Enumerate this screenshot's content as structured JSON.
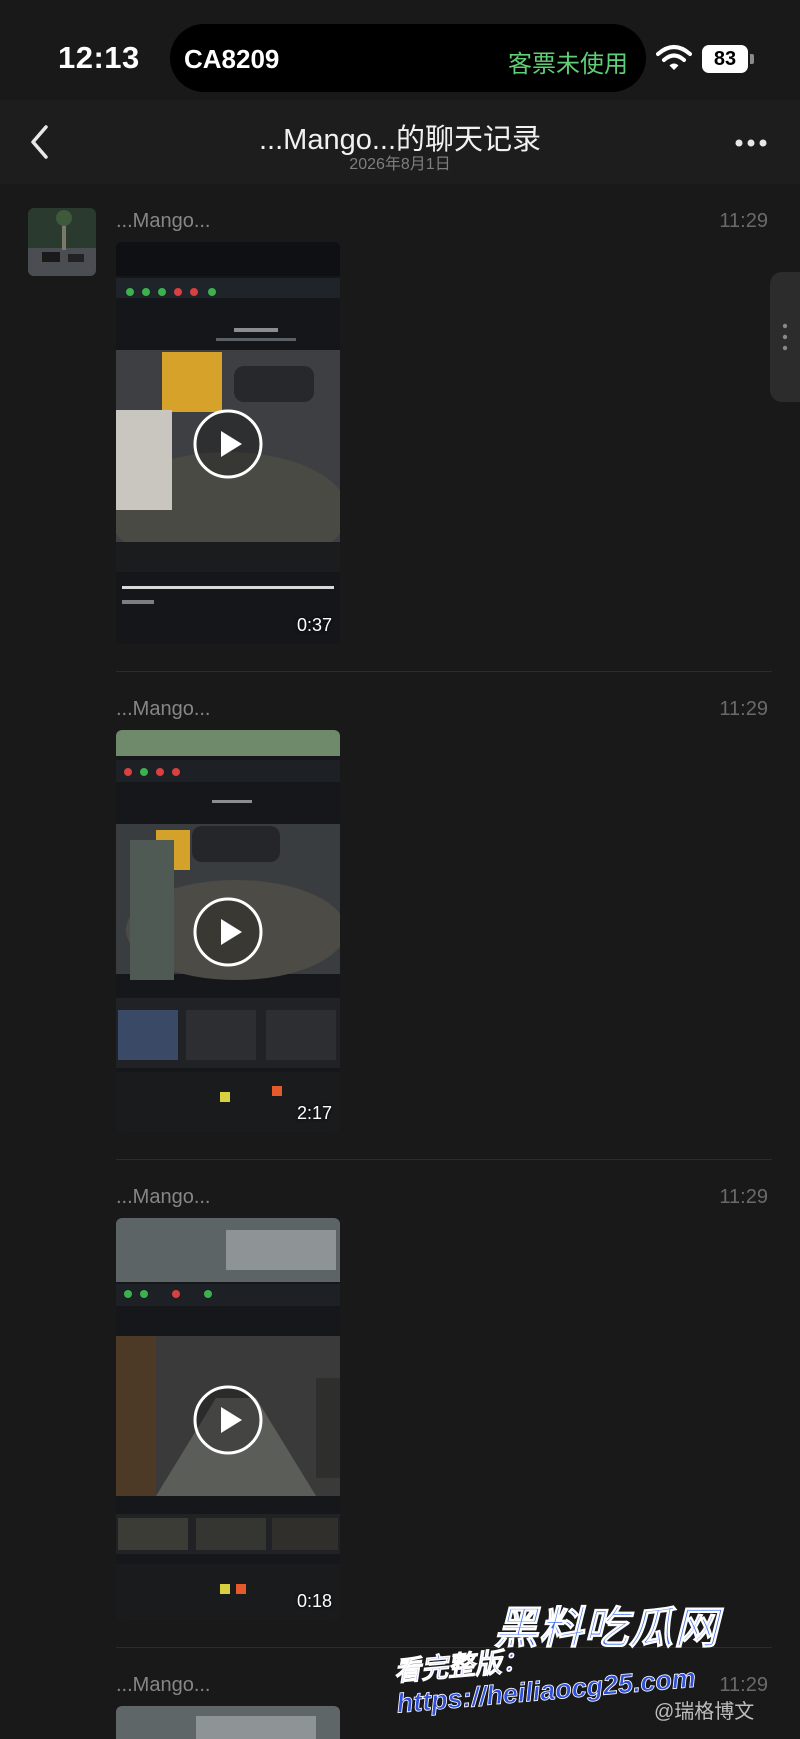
{
  "status_bar": {
    "time": "12:13",
    "flight": "CA8209",
    "ticket_status": "客票未使用",
    "battery": "83"
  },
  "nav": {
    "title": "...Mango...的聊天记录",
    "subtitle": "2026年8月1日"
  },
  "messages": [
    {
      "sender": "...Mango...",
      "time": "11:29",
      "duration": "0:37"
    },
    {
      "sender": "...Mango...",
      "time": "11:29",
      "duration": "2:17"
    },
    {
      "sender": "...Mango...",
      "time": "11:29",
      "duration": "0:18"
    },
    {
      "sender": "...Mango...",
      "time": "11:29",
      "duration": ""
    }
  ],
  "watermark": {
    "brand": "黑料吃瓜网",
    "line": "看完整版：https://heiliaocg25.com",
    "weibo": "@瑞格博文"
  },
  "colors": {
    "background": "#191919",
    "ticket_status": "#5fce76",
    "watermark_blue": "#3c6cf2"
  },
  "icons": [
    "back-icon",
    "more-icon",
    "wifi-icon",
    "battery-icon",
    "play-icon"
  ]
}
